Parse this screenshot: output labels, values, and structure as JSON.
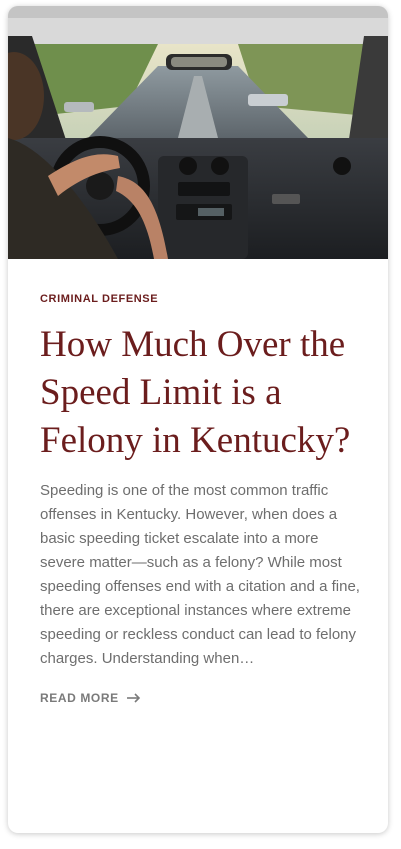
{
  "post": {
    "image_alt": "Driver steering a car on a city street",
    "category": "CRIMINAL DEFENSE",
    "title": "How Much Over the Speed Limit is a Felony in Kentucky?",
    "excerpt": "Speeding is one of the most common traffic offenses in Kentucky. However, when does a basic speeding ticket escalate into a more severe matter—such as a felony? While most speeding offenses end with a citation and a fine, there are exceptional instances where extreme speeding or reckless conduct can lead to felony charges. Understanding when…",
    "read_more_label": "READ MORE",
    "read_more_icon": "arrow-right-icon"
  },
  "colors": {
    "accent": "#6b1d1d",
    "body_text": "#6e6e6e",
    "muted": "#7a7a7a"
  }
}
